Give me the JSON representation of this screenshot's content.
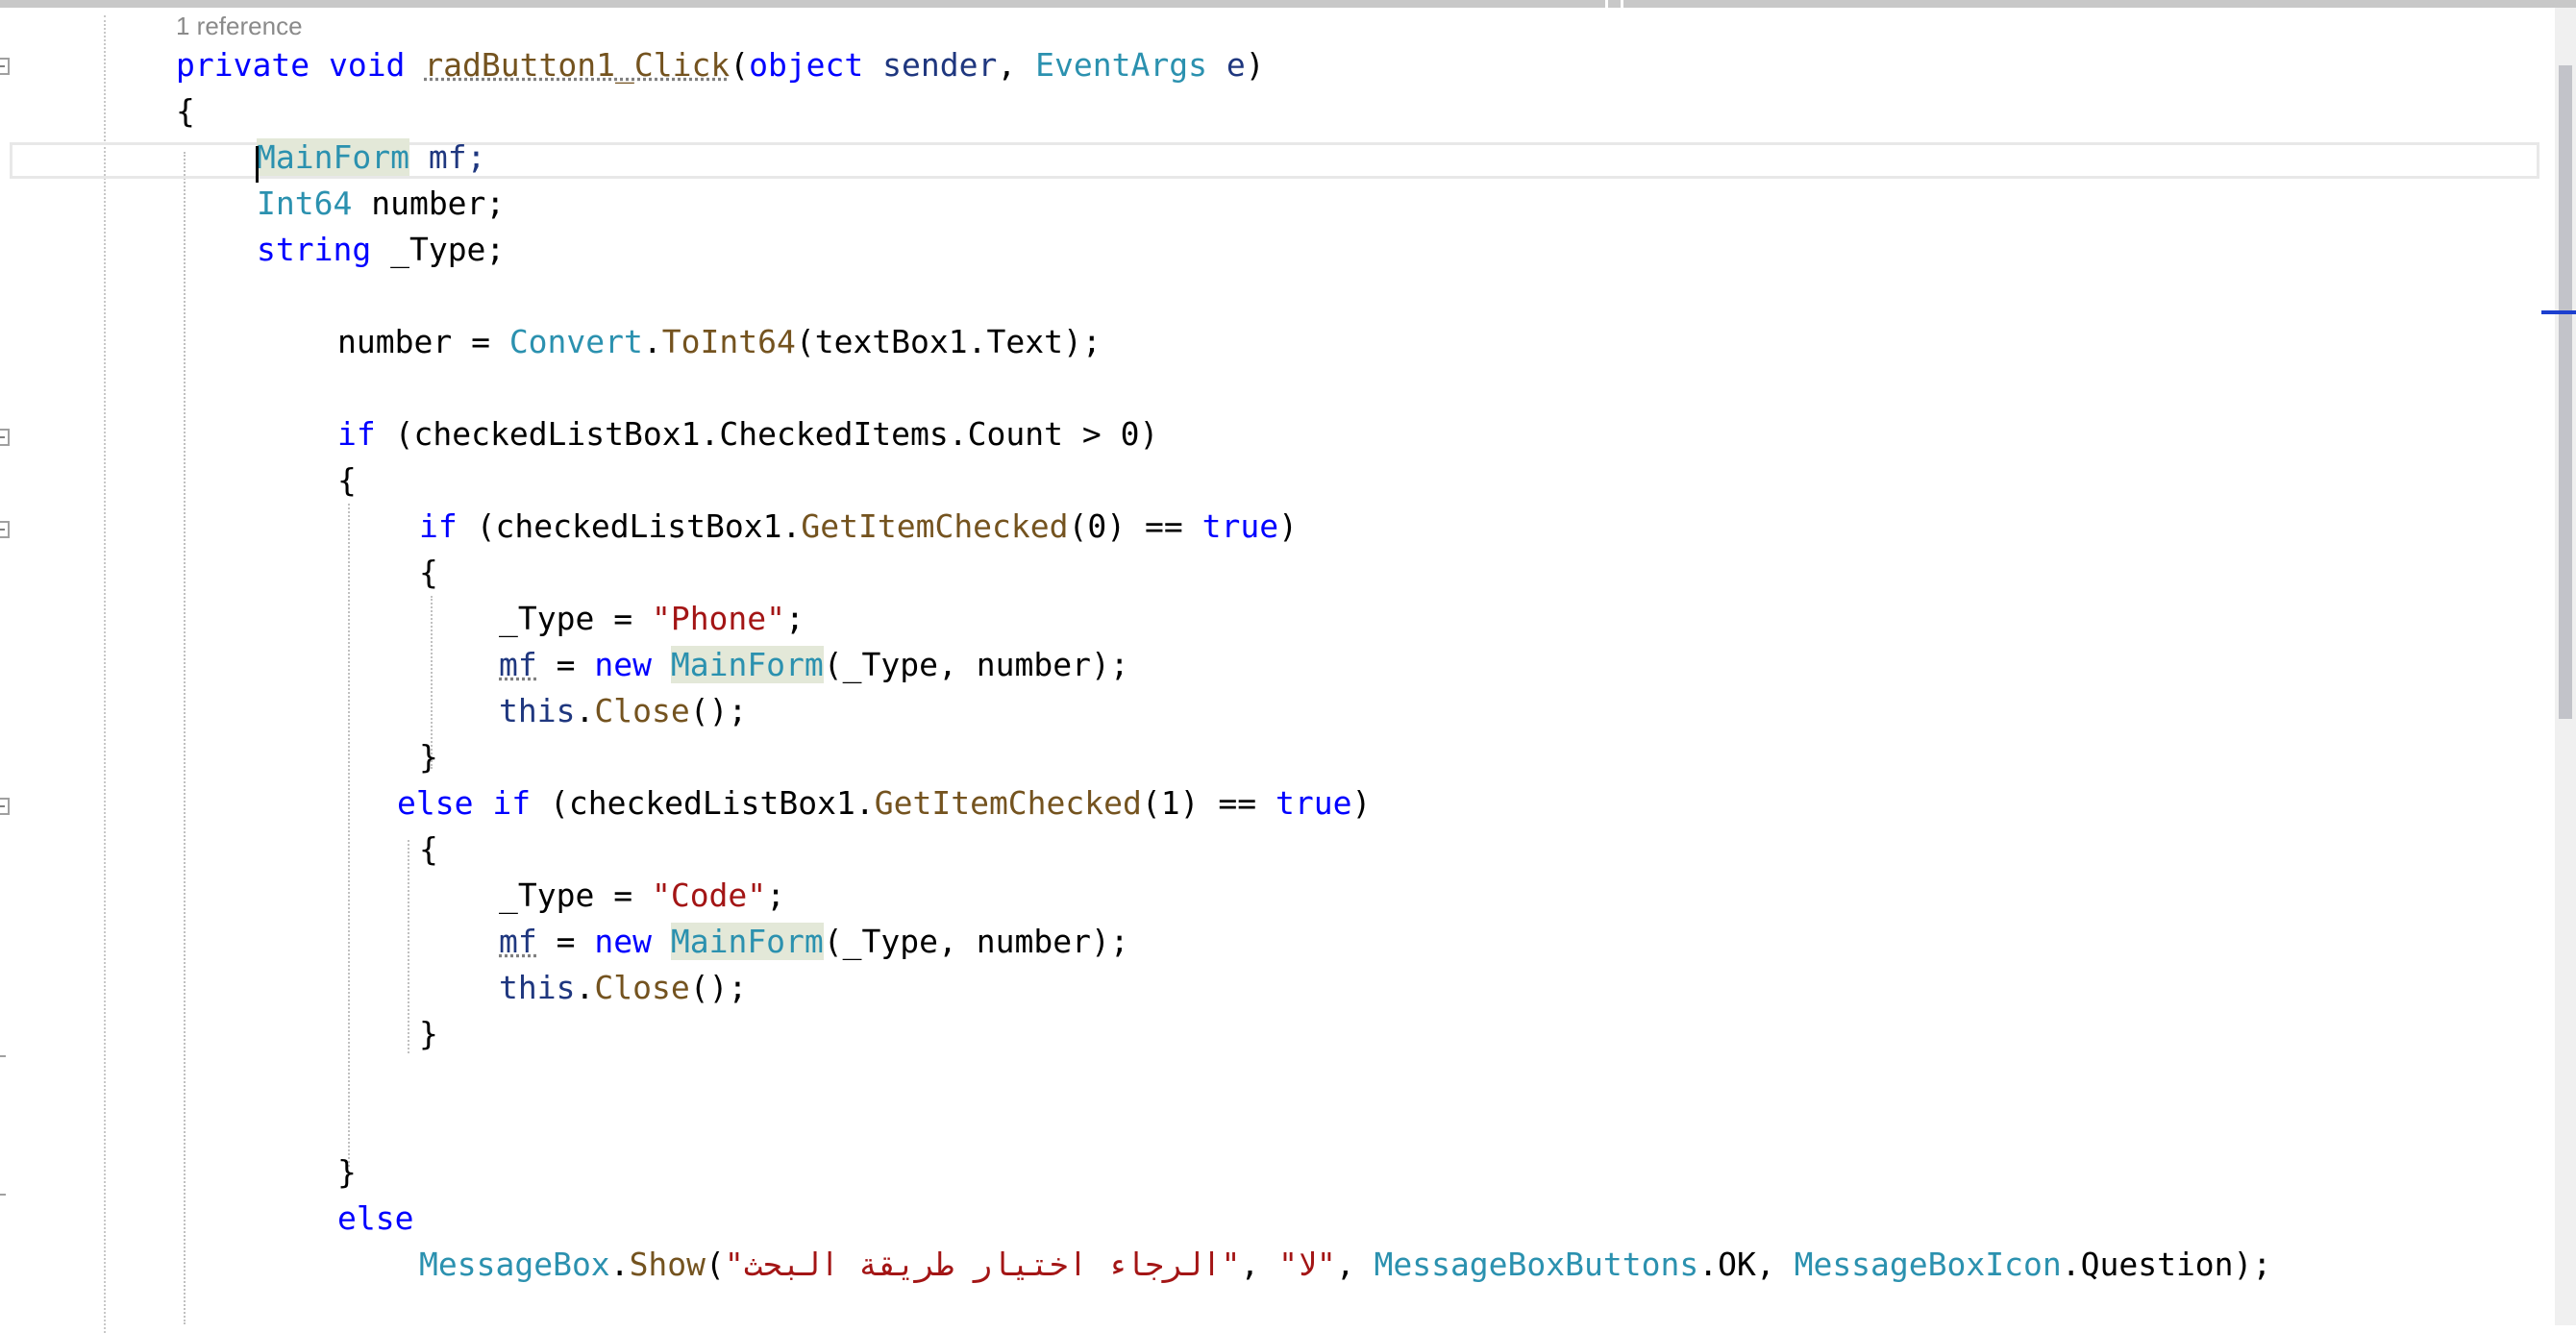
{
  "editor": {
    "codelens": "1 reference",
    "lines": {
      "sig": {
        "a": "private",
        "b": "void",
        "c": "radButton1_Click",
        "d": "(",
        "e": "object",
        "f": "sender",
        "g": ", ",
        "h": "EventArgs",
        "i": "e",
        "j": ")"
      },
      "open1": "{",
      "mf_decl": {
        "type": "MainForm",
        "rest": " mf;"
      },
      "num_decl": {
        "type": "Int64",
        "rest": " number;"
      },
      "type_decl": {
        "kw": "string",
        "rest": " _Type;"
      },
      "assign": {
        "a": "number = ",
        "b": "Convert",
        "c": ".",
        "d": "ToInt64",
        "e": "(textBox1.Text);"
      },
      "if1": {
        "kw": "if",
        "a": " (checkedListBox1.CheckedItems.Count > 0)"
      },
      "open2": "{",
      "if2": {
        "kw": "if",
        "a": " (checkedListBox1.",
        "m": "GetItemChecked",
        "b": "(0) == ",
        "t": "true",
        "c": ")"
      },
      "open3": "{",
      "phone_assign": {
        "a": "_Type = ",
        "s": "\"Phone\"",
        "b": ";"
      },
      "new_mf1": {
        "v": "mf",
        "a": " = ",
        "kw": "new",
        "sp": " ",
        "t": "MainForm",
        "b": "(_Type, number);"
      },
      "close1": {
        "kw": "this",
        "a": ".",
        "m": "Close",
        "b": "();"
      },
      "close3": "}",
      "elseif": {
        "kw1": "else",
        "sp": " ",
        "kw2": "if",
        "a": " (checkedListBox1.",
        "m": "GetItemChecked",
        "b": "(1) == ",
        "t": "true",
        "c": ")"
      },
      "open4": "{",
      "code_assign": {
        "a": "_Type = ",
        "s": "\"Code\"",
        "b": ";"
      },
      "new_mf2": {
        "v": "mf",
        "a": " = ",
        "kw": "new",
        "sp": " ",
        "t": "MainForm",
        "b": "(_Type, number);"
      },
      "close2": {
        "kw": "this",
        "a": ".",
        "m": "Close",
        "b": "();"
      },
      "close4": "}",
      "close5": "}",
      "else": "else",
      "msgbox": {
        "t1": "MessageBox",
        "a": ".",
        "m": "Show",
        "b": "(",
        "s1": "\"الرجاء اختيار طريقة البحث\"",
        "c": ", ",
        "s2": "\"لا\"",
        "d": ", ",
        "t2": "MessageBoxButtons",
        "e": ".OK, ",
        "t3": "MessageBoxIcon",
        "f": ".Question);"
      }
    }
  },
  "colors": {
    "keyword": "#0000ff",
    "type": "#2b91af",
    "method": "#74531f",
    "string": "#a31515",
    "local": "#1f377f"
  }
}
